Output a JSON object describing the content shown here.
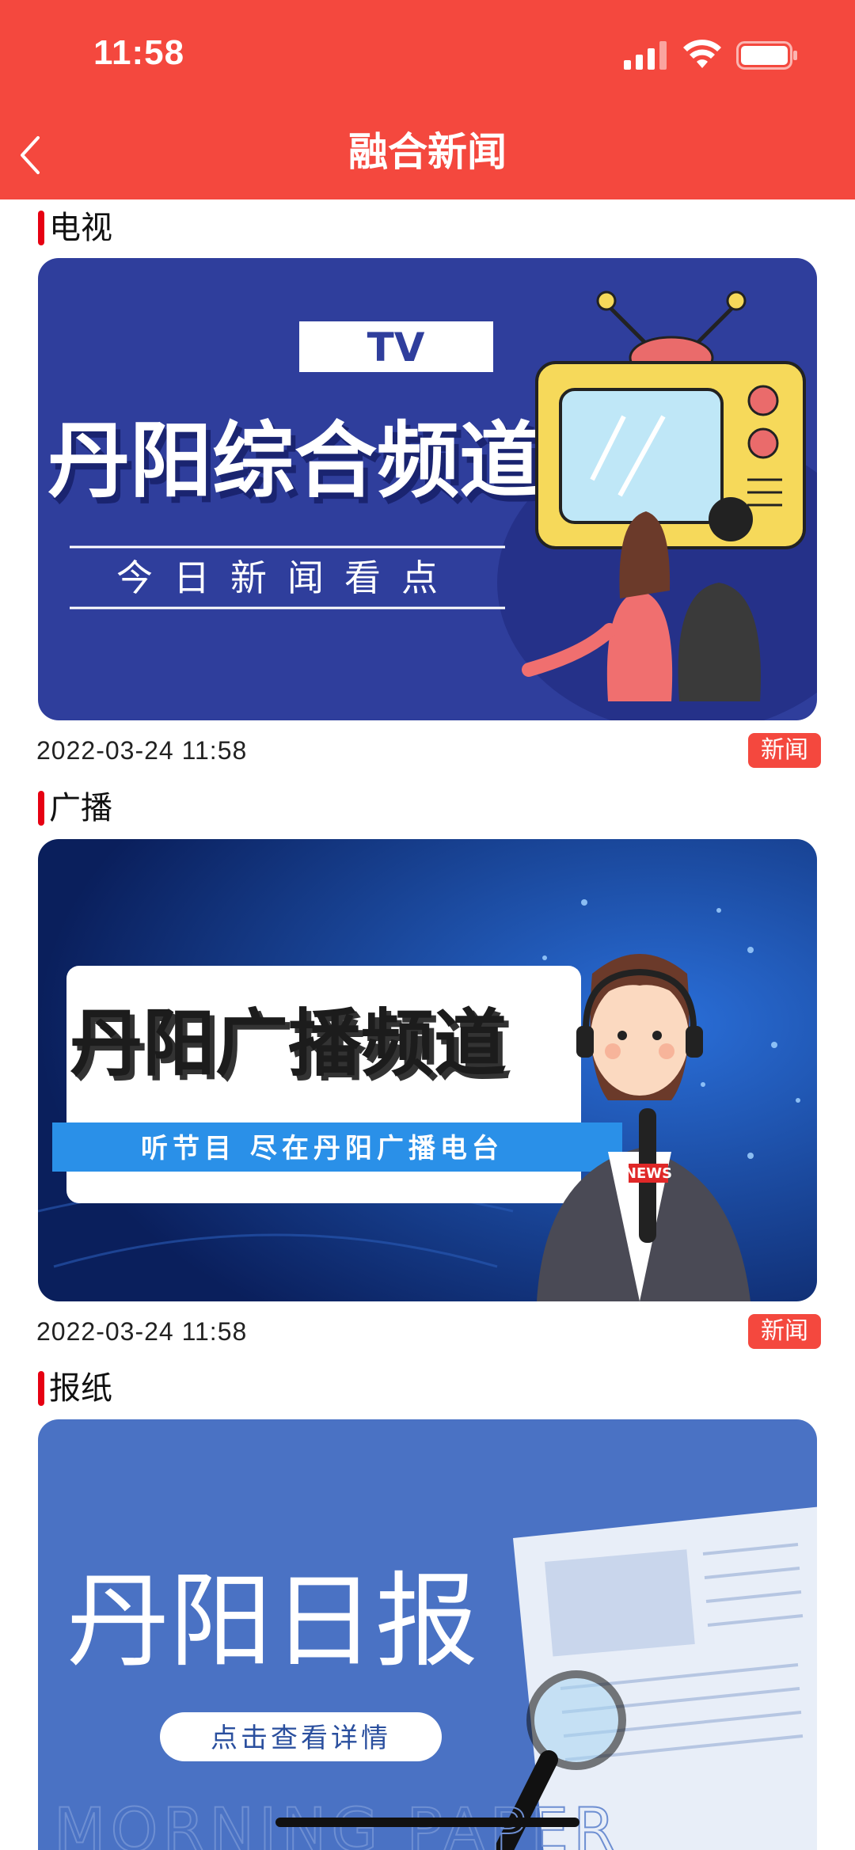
{
  "status_bar": {
    "time": "11:58",
    "icons": [
      "signal-icon",
      "wifi-icon",
      "battery-icon"
    ]
  },
  "nav": {
    "title": "融合新闻",
    "back_icon": "chevron-left-icon"
  },
  "sections": [
    {
      "title": "电视",
      "banner": {
        "badge": "TV",
        "headline": "丹阳综合频道",
        "subline": "今日新闻看点"
      },
      "date": "2022-03-24 11:58",
      "tag": "新闻"
    },
    {
      "title": "广播",
      "banner": {
        "headline": "丹阳广播频道",
        "subline": "听节目   尽在丹阳广播电台",
        "mic_label": "NEWS"
      },
      "date": "2022-03-24 11:58",
      "tag": "新闻"
    },
    {
      "title": "报纸",
      "banner": {
        "headline": "丹阳日报",
        "button": "点击查看详情",
        "watermark": "MORNING PAPER"
      }
    }
  ],
  "colors": {
    "header": "#f4483e",
    "accent_bar": "#e60012",
    "tv_bg": "#2f3e9c",
    "radio_bg": "#0e2f7a",
    "paper_bg": "#4a72c4"
  }
}
